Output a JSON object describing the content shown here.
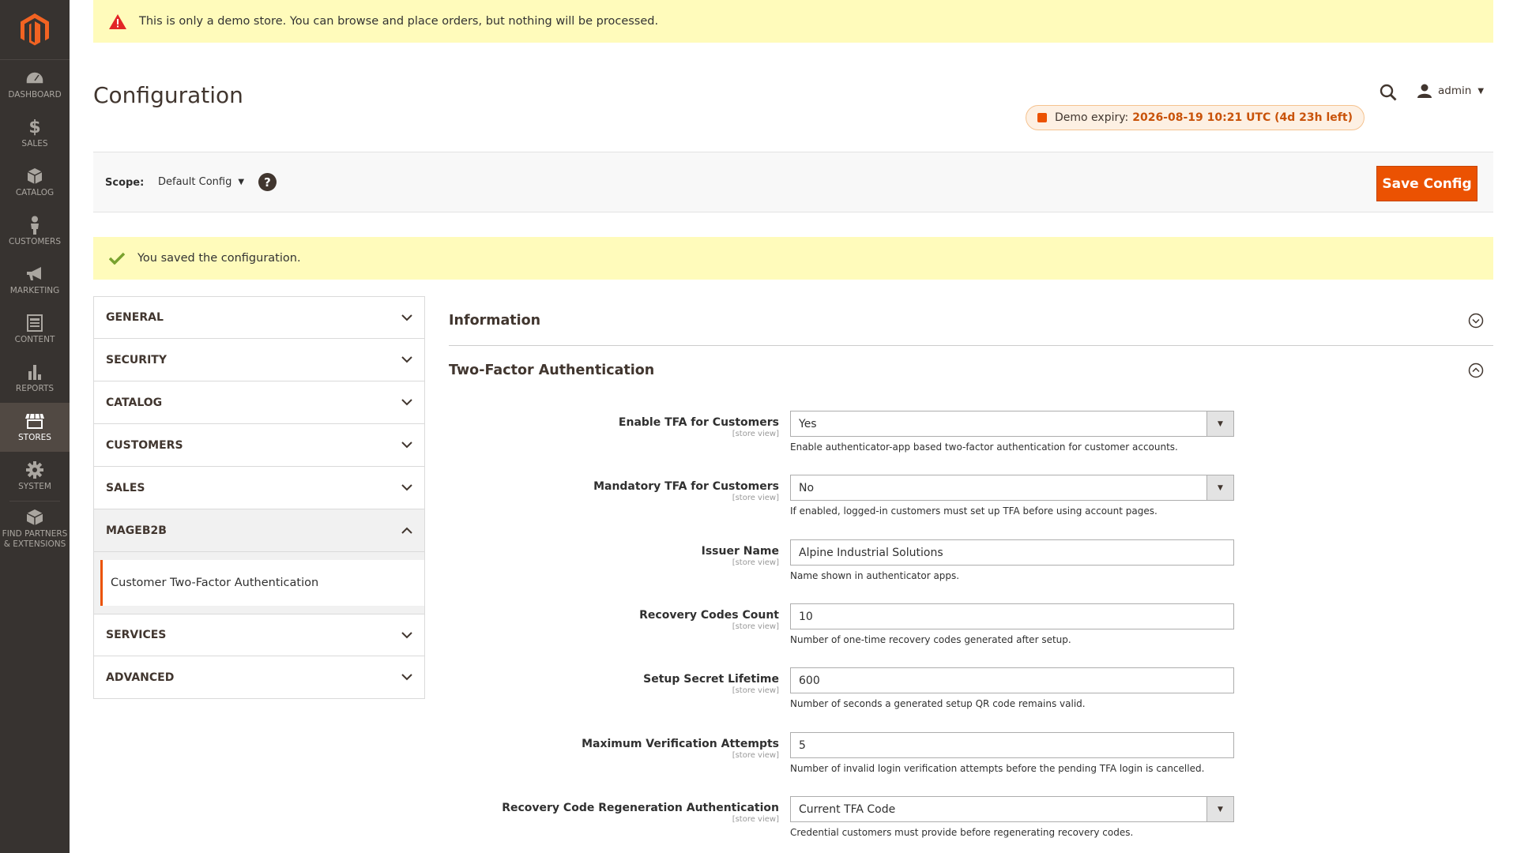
{
  "sidebar": {
    "items": [
      {
        "label": "DASHBOARD",
        "icon": "dashboard-icon"
      },
      {
        "label": "$",
        "sub": "SALES",
        "icon": "dollar-icon"
      },
      {
        "label": "CATALOG",
        "icon": "catalog-box-icon"
      },
      {
        "label": "CUSTOMERS",
        "icon": "customer-person-icon"
      },
      {
        "label": "MARKETING",
        "icon": "megaphone-icon"
      },
      {
        "label": "CONTENT",
        "icon": "content-layout-icon"
      },
      {
        "label": "REPORTS",
        "icon": "bar-chart-icon"
      },
      {
        "label": "STORES",
        "icon": "storefront-icon",
        "active": true
      },
      {
        "label": "SYSTEM",
        "icon": "gear-icon"
      },
      {
        "label": "FIND PARTNERS & EXTENSIONS",
        "icon": "extensions-box-icon"
      }
    ]
  },
  "demo_notice": "This is only a demo store. You can browse and place orders, but nothing will be processed.",
  "page_title": "Configuration",
  "header": {
    "user_name": "admin",
    "expiry_prefix": "Demo expiry:",
    "expiry_value": "2026-08-19 10:21 UTC (4d 23h left)"
  },
  "scope": {
    "label": "Scope:",
    "value": "Default Config",
    "help": "?",
    "save_label": "Save Config"
  },
  "success_message": "You saved the configuration.",
  "tabs": [
    {
      "label": "GENERAL"
    },
    {
      "label": "SECURITY"
    },
    {
      "label": "CATALOG"
    },
    {
      "label": "CUSTOMERS"
    },
    {
      "label": "SALES"
    },
    {
      "label": "MAGEB2B",
      "open": true,
      "items": [
        "Customer Two-Factor Authentication"
      ]
    },
    {
      "label": "SERVICES"
    },
    {
      "label": "ADVANCED"
    }
  ],
  "sections": {
    "information": {
      "title": "Information"
    },
    "tfa": {
      "title": "Two-Factor Authentication"
    }
  },
  "fields": [
    {
      "label": "Enable TFA for Customers",
      "scope": "[store view]",
      "type": "select",
      "value": "Yes",
      "note": "Enable authenticator-app based two-factor authentication for customer accounts."
    },
    {
      "label": "Mandatory TFA for Customers",
      "scope": "[store view]",
      "type": "select",
      "value": "No",
      "note": "If enabled, logged-in customers must set up TFA before using account pages."
    },
    {
      "label": "Issuer Name",
      "scope": "[store view]",
      "type": "text",
      "value": "Alpine Industrial Solutions",
      "note": "Name shown in authenticator apps."
    },
    {
      "label": "Recovery Codes Count",
      "scope": "[store view]",
      "type": "text",
      "value": "10",
      "note": "Number of one-time recovery codes generated after setup."
    },
    {
      "label": "Setup Secret Lifetime",
      "scope": "[store view]",
      "type": "text",
      "value": "600",
      "note": "Number of seconds a generated setup QR code remains valid."
    },
    {
      "label": "Maximum Verification Attempts",
      "scope": "[store view]",
      "type": "text",
      "value": "5",
      "note": "Number of invalid login verification attempts before the pending TFA login is cancelled."
    },
    {
      "label": "Recovery Code Regeneration Authentication",
      "scope": "[store view]",
      "type": "select",
      "value": "Current TFA Code",
      "note": "Credential customers must provide before regenerating recovery codes."
    }
  ],
  "colors": {
    "accent": "#eb5202",
    "sidebar": "#373330",
    "notice": "#fffbbb"
  }
}
